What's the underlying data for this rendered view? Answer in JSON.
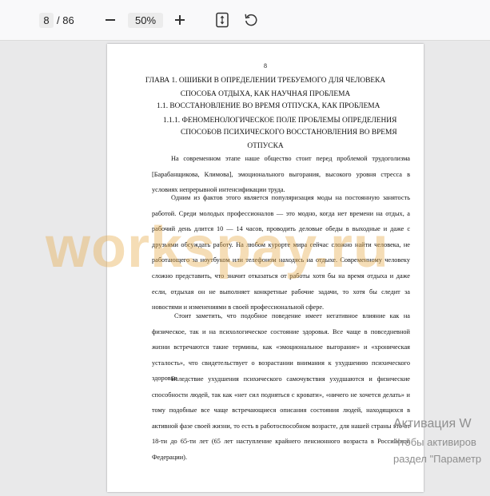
{
  "toolbar": {
    "current_page": "8",
    "page_separator": "/ 86",
    "zoom": "50%",
    "icons": {
      "zoom_out": "minus-icon",
      "zoom_in": "plus-icon",
      "fit": "fit-to-page-icon",
      "rotate": "rotate-icon"
    }
  },
  "document": {
    "page_number": "8",
    "heading_line1": "ГЛАВА 1. ОШИБКИ В ОПРЕДЕЛЕНИИ ТРЕБУЕМОГО ДЛЯ ЧЕЛОВЕКА",
    "heading_line2": "СПОСОБА ОТДЫХА, КАК НАУЧНАЯ ПРОБЛЕМА",
    "section_1_1": "1.1.    ВОССТАНОВЛЕНИЕ ВО ВРЕМЯ ОТПУСКА, КАК ПРОБЛЕМА",
    "section_1_1_1_line1": "1.1.1. ФЕНОМЕНОЛОГИЧЕСКОЕ ПОЛЕ ПРОБЛЕМЫ ОПРЕДЕЛЕНИЯ",
    "section_1_1_1_line2": "СПОСОБОВ ПСИХИЧЕСКОГО ВОССТАНОВЛЕНИЯ ВО ВРЕМЯ",
    "section_1_1_1_line3": "ОТПУСКА",
    "paragraphs": [
      "На современном этапе наше общество стоит перед проблемой трудоголизма [Барабанщикова, Климова], эмоционального выгорания, высокого уровня стресса в условиях непрерывной интенсификации труда.",
      "Одним из фактов этого является популяризация моды на постоянную занятость работой. Среди молодых профессионалов — это модно, когда нет времени на отдых, а рабочий день длится 10 — 14 часов, проводить деловые обеды в выходные и даже с друзьями обсуждать работу. На любом курорте мира сейчас сложно найти человека, не работающего за ноутбуком или телефоном находясь на отдыхе. Современному человеку сложно представить, что значит отказаться от работы хотя бы на время отдыха и даже если, отдыхая он не выполняет конкретные рабочие задачи, то хотя бы следит за новостями и изменениями в своей профессиональной сфере.",
      "Стоит заметить, что подобное поведение имеет негативное влияние как на физическое, так и на психологическое состояние здоровья. Все чаще в повседневной жизни встречаются такие термины, как «эмоциональное выгорание» и «хроническая усталость», что свидетельствует о возрастании внимания к ухудшению психического здоровья.",
      "Вследствие ухудшения психического самочувствия ухудшаются и физические способности людей, так как «нет сил подняться с кровати», «ничего не хочется делать» и тому подобные все чаще встречающиеся описания состояния людей, находящихся в активной фазе своей жизни, то есть в работоспособном возрасте, для нашей страны это от 18-ти до 65-ти лет (65 лет наступление крайнего пенсионного возраста в Российской Федерации)."
    ]
  },
  "watermark": "workspay.ru",
  "windows_activation": {
    "line1": "Активация W",
    "line2": "Чтобы активиров",
    "line3": "раздел \"Параметр"
  }
}
